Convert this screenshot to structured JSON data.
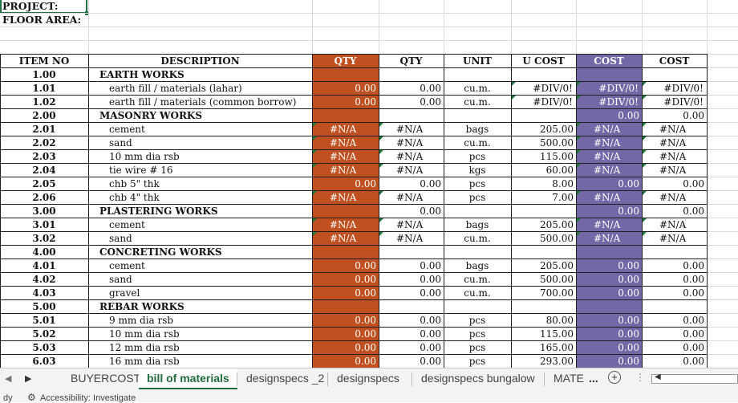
{
  "header": {
    "project_label": "PROJECT:",
    "floor_area_label": "FLOOR AREA:"
  },
  "colors": {
    "qty_column": "#c0501f",
    "cost_column": "#7268a6",
    "active_tab": "#1e6b3b"
  },
  "columns": [
    "ITEM NO",
    "DESCRIPTION",
    "QTY",
    "QTY",
    "UNIT",
    "U COST",
    "COST",
    "COST"
  ],
  "rows": [
    {
      "item": "1.00",
      "desc": "EARTH WORKS",
      "section": true,
      "qty1": "",
      "qty2": "",
      "unit": "",
      "ucost": "",
      "cost1": "",
      "cost2": ""
    },
    {
      "item": "1.01",
      "desc": "earth fill / materials (lahar)",
      "section": false,
      "qty1": "0.00",
      "qty2": "0.00",
      "unit": "cu.m.",
      "ucost": "#DIV/0!",
      "cost1": "#DIV/0!",
      "cost2": "#DIV/0!"
    },
    {
      "item": "1.02",
      "desc": "earth fill / materials (common borrow)",
      "section": false,
      "qty1": "0.00",
      "qty2": "0.00",
      "unit": "cu.m.",
      "ucost": "#DIV/0!",
      "cost1": "#DIV/0!",
      "cost2": "#DIV/0!"
    },
    {
      "item": "2.00",
      "desc": "MASONRY WORKS",
      "section": true,
      "qty1": "",
      "qty2": "",
      "unit": "",
      "ucost": "",
      "cost1": "0.00",
      "cost2": "0.00"
    },
    {
      "item": "2.01",
      "desc": "cement",
      "section": false,
      "qty1": "#N/A",
      "qty2": "#N/A",
      "unit": "bags",
      "ucost": "205.00",
      "cost1": "#N/A",
      "cost2": "#N/A"
    },
    {
      "item": "2.02",
      "desc": "sand",
      "section": false,
      "qty1": "#N/A",
      "qty2": "#N/A",
      "unit": "cu.m.",
      "ucost": "500.00",
      "cost1": "#N/A",
      "cost2": "#N/A"
    },
    {
      "item": "2.03",
      "desc": "10 mm dia rsb",
      "section": false,
      "qty1": "#N/A",
      "qty2": "#N/A",
      "unit": "pcs",
      "ucost": "115.00",
      "cost1": "#N/A",
      "cost2": "#N/A"
    },
    {
      "item": "2.04",
      "desc": "tie wire # 16",
      "section": false,
      "qty1": "#N/A",
      "qty2": "#N/A",
      "unit": "kgs",
      "ucost": "60.00",
      "cost1": "#N/A",
      "cost2": "#N/A"
    },
    {
      "item": "2.05",
      "desc": "chb 5\" thk",
      "section": false,
      "qty1": "0.00",
      "qty2": "0.00",
      "unit": "pcs",
      "ucost": "8.00",
      "cost1": "0.00",
      "cost2": "0.00"
    },
    {
      "item": "2.06",
      "desc": "chb 4\" thk",
      "section": false,
      "qty1": "#N/A",
      "qty2": "#N/A",
      "unit": "pcs",
      "ucost": "7.00",
      "cost1": "#N/A",
      "cost2": "#N/A"
    },
    {
      "item": "3.00",
      "desc": "PLASTERING WORKS",
      "section": true,
      "qty1": "",
      "qty2": "0.00",
      "unit": "",
      "ucost": "",
      "cost1": "0.00",
      "cost2": "0.00"
    },
    {
      "item": "3.01",
      "desc": "cement",
      "section": false,
      "qty1": "#N/A",
      "qty2": "#N/A",
      "unit": "bags",
      "ucost": "205.00",
      "cost1": "#N/A",
      "cost2": "#N/A"
    },
    {
      "item": "3.02",
      "desc": "sand",
      "section": false,
      "qty1": "#N/A",
      "qty2": "#N/A",
      "unit": "cu.m.",
      "ucost": "500.00",
      "cost1": "#N/A",
      "cost2": "#N/A"
    },
    {
      "item": "4.00",
      "desc": "CONCRETING WORKS",
      "section": true,
      "qty1": "",
      "qty2": "",
      "unit": "",
      "ucost": "",
      "cost1": "",
      "cost2": ""
    },
    {
      "item": "4.01",
      "desc": "cement",
      "section": false,
      "qty1": "0.00",
      "qty2": "0.00",
      "unit": "bags",
      "ucost": "205.00",
      "cost1": "0.00",
      "cost2": "0.00"
    },
    {
      "item": "4.02",
      "desc": "sand",
      "section": false,
      "qty1": "0.00",
      "qty2": "0.00",
      "unit": "cu.m.",
      "ucost": "500.00",
      "cost1": "0.00",
      "cost2": "0.00"
    },
    {
      "item": "4.03",
      "desc": "gravel",
      "section": false,
      "qty1": "0.00",
      "qty2": "0.00",
      "unit": "cu.m.",
      "ucost": "700.00",
      "cost1": "0.00",
      "cost2": "0.00"
    },
    {
      "item": "5.00",
      "desc": "REBAR WORKS",
      "section": true,
      "qty1": "",
      "qty2": "",
      "unit": "",
      "ucost": "",
      "cost1": "",
      "cost2": ""
    },
    {
      "item": "5.01",
      "desc": "9 mm dia rsb",
      "section": false,
      "qty1": "0.00",
      "qty2": "0.00",
      "unit": "pcs",
      "ucost": "80.00",
      "cost1": "0.00",
      "cost2": "0.00"
    },
    {
      "item": "5.02",
      "desc": "10 mm dia rsb",
      "section": false,
      "qty1": "0.00",
      "qty2": "0.00",
      "unit": "pcs",
      "ucost": "115.00",
      "cost1": "0.00",
      "cost2": "0.00"
    },
    {
      "item": "5.03",
      "desc": "12 mm dia rsb",
      "section": false,
      "qty1": "0.00",
      "qty2": "0.00",
      "unit": "pcs",
      "ucost": "165.00",
      "cost1": "0.00",
      "cost2": "0.00"
    },
    {
      "item": "6.03",
      "desc": "16 mm dia rsb",
      "section": false,
      "qty1": "0.00",
      "qty2": "0.00",
      "unit": "pcs",
      "ucost": "293.00",
      "cost1": "0.00",
      "cost2": "0.00"
    }
  ],
  "sheet_tabs": {
    "items": [
      "BUYERCOST",
      "bill of materials",
      "designspecs _2",
      "designspecs",
      "designspecs bungalow",
      "MATE"
    ],
    "active": "bill of materials",
    "more_label": "...",
    "add_icon": "plus-circle-icon"
  },
  "status_bar": {
    "left": "dy",
    "accessibility": "Accessibility: Investigate"
  }
}
